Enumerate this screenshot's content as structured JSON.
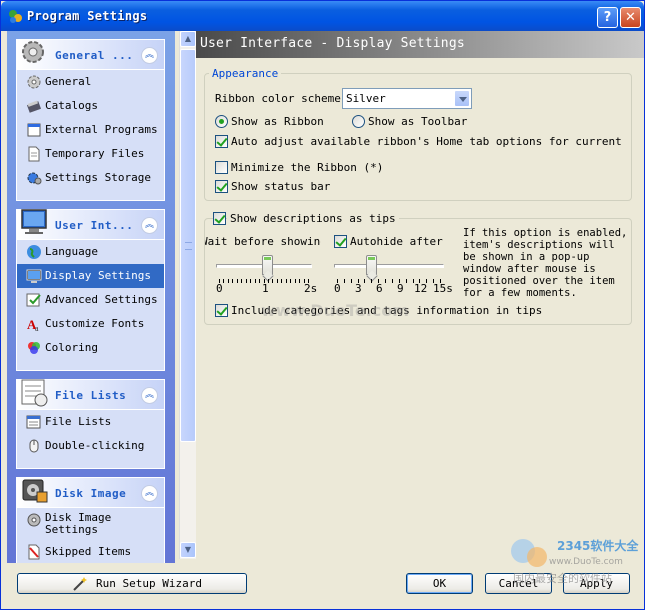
{
  "window": {
    "title": "Program Settings",
    "help_glyph": "?",
    "close_glyph": "✕"
  },
  "sidebar": {
    "groups": [
      {
        "title": "General ...",
        "icon": "gear-icon",
        "items": [
          {
            "label": "General",
            "icon": "gear-small-icon"
          },
          {
            "label": "Catalogs",
            "icon": "catalog-icon"
          },
          {
            "label": "External Programs",
            "icon": "external-program-icon"
          },
          {
            "label": "Temporary Files",
            "icon": "file-icon"
          },
          {
            "label": "Settings Storage",
            "icon": "storage-gear-icon"
          }
        ]
      },
      {
        "title": "User Int...",
        "icon": "monitor-icon",
        "items": [
          {
            "label": "Language",
            "icon": "globe-icon"
          },
          {
            "label": "Display Settings",
            "icon": "display-icon",
            "selected": true
          },
          {
            "label": "Advanced Settings",
            "icon": "advanced-settings-icon"
          },
          {
            "label": "Customize Fonts",
            "icon": "font-icon"
          },
          {
            "label": "Coloring",
            "icon": "color-palette-icon"
          }
        ]
      },
      {
        "title": "File Lists",
        "icon": "file-list-icon",
        "items": [
          {
            "label": "File Lists",
            "icon": "list-icon"
          },
          {
            "label": "Double-clicking",
            "icon": "mouse-icon"
          }
        ]
      },
      {
        "title": "Disk Image",
        "icon": "disk-image-icon",
        "items": [
          {
            "label": "Disk Image Settings",
            "icon": "disk-icon"
          },
          {
            "label": "Skipped Items",
            "icon": "skip-icon"
          }
        ]
      }
    ],
    "collapse_glyph": "︽",
    "scroll_up": "▲",
    "scroll_down": "▼"
  },
  "main": {
    "header_title": "User Interface - Display Settings",
    "appearance": {
      "legend": "Appearance",
      "ribbon_scheme_label": "Ribbon color scheme:",
      "ribbon_scheme_value": "Silver",
      "show_as_ribbon": "Show as Ribbon",
      "show_as_toolbar": "Show as Toolbar",
      "auto_adjust": "Auto adjust available ribbon's Home tab options for current select",
      "minimize_ribbon": "Minimize the Ribbon (*)",
      "show_status_bar": "Show status bar"
    },
    "tips": {
      "show_descriptions": "Show descriptions as tips",
      "wait_before_showing": "Wait before showing",
      "autohide_after": "Autohide after",
      "wait_ticks": [
        "0",
        "1",
        "2s"
      ],
      "wait_value_s": 1,
      "autohide_ticks": [
        "0",
        "3",
        "6",
        "9",
        "12",
        "15s"
      ],
      "autohide_value_s": 3,
      "description": "If this option is enabled, item's descriptions will be shown in a pop-up window after mouse is positioned over the item for a few moments.",
      "include_categories": "Include categories and tags information in tips"
    }
  },
  "buttons": {
    "wizard": "Run Setup Wizard",
    "ok": "OK",
    "cancel": "Cancel",
    "apply": "Apply"
  },
  "watermark": "www.DuoTe.com",
  "corner_watermark": {
    "brand": "2345软件大全",
    "url": "www.DuoTe.com",
    "tagline": "国内最安全的软件站"
  }
}
